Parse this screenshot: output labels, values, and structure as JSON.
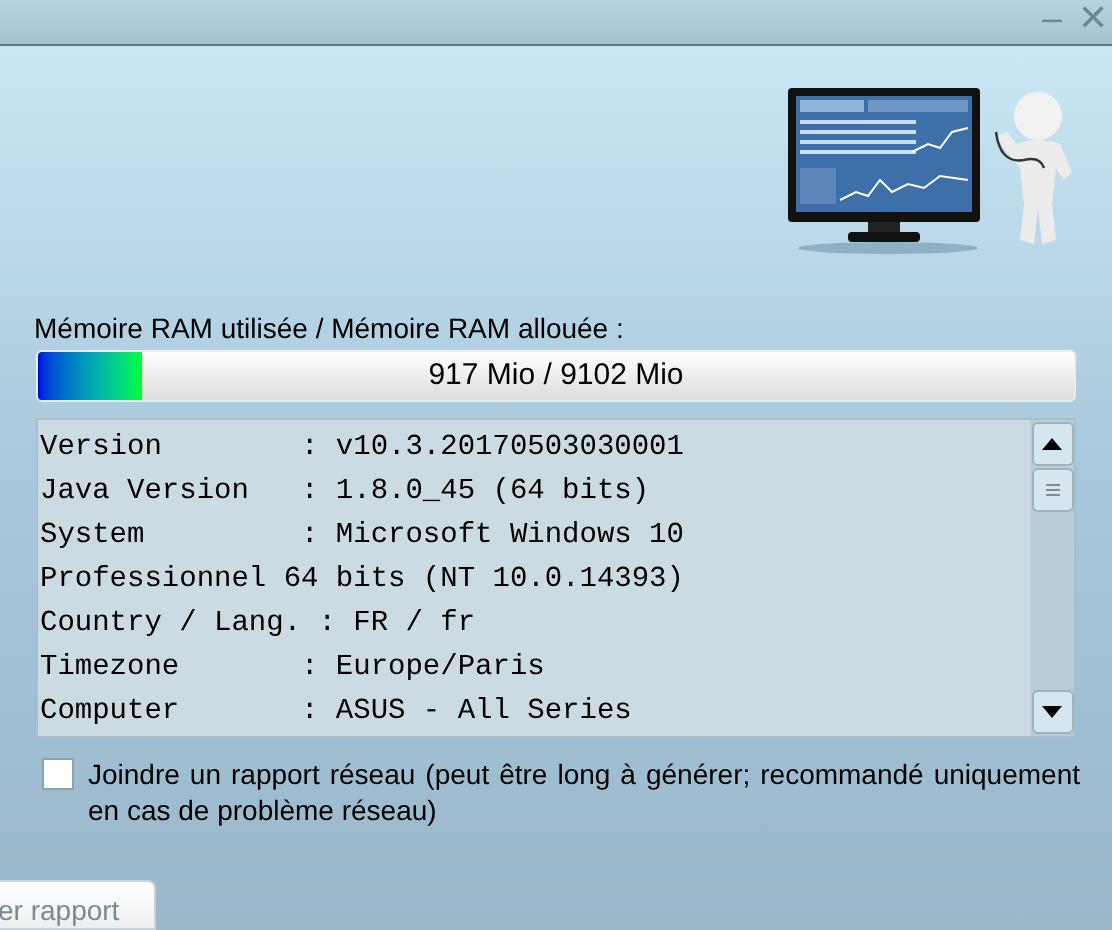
{
  "window": {
    "controls": [
      "–",
      "✕"
    ]
  },
  "memory": {
    "label": "Mémoire RAM utilisée / Mémoire RAM allouée :",
    "level": 0.1,
    "reading": "917 Mio / 9102 Mio"
  },
  "info_lines": [
    "Version        : v10.3.20170503030001",
    "Java Version   : 1.8.0_45 (64 bits)",
    "System         : Microsoft Windows 10",
    "Professionnel 64 bits (NT 10.0.14393)",
    "Country / Lang. : FR / fr",
    "Timezone       : Europe/Paris",
    "Computer       : ASUS - All Series"
  ],
  "network_report": {
    "label": "Joindre un rapport réseau (peut être long à générer; recommandé uniquement en cas de problème réseau)",
    "checked": false
  },
  "button": "er rapport"
}
